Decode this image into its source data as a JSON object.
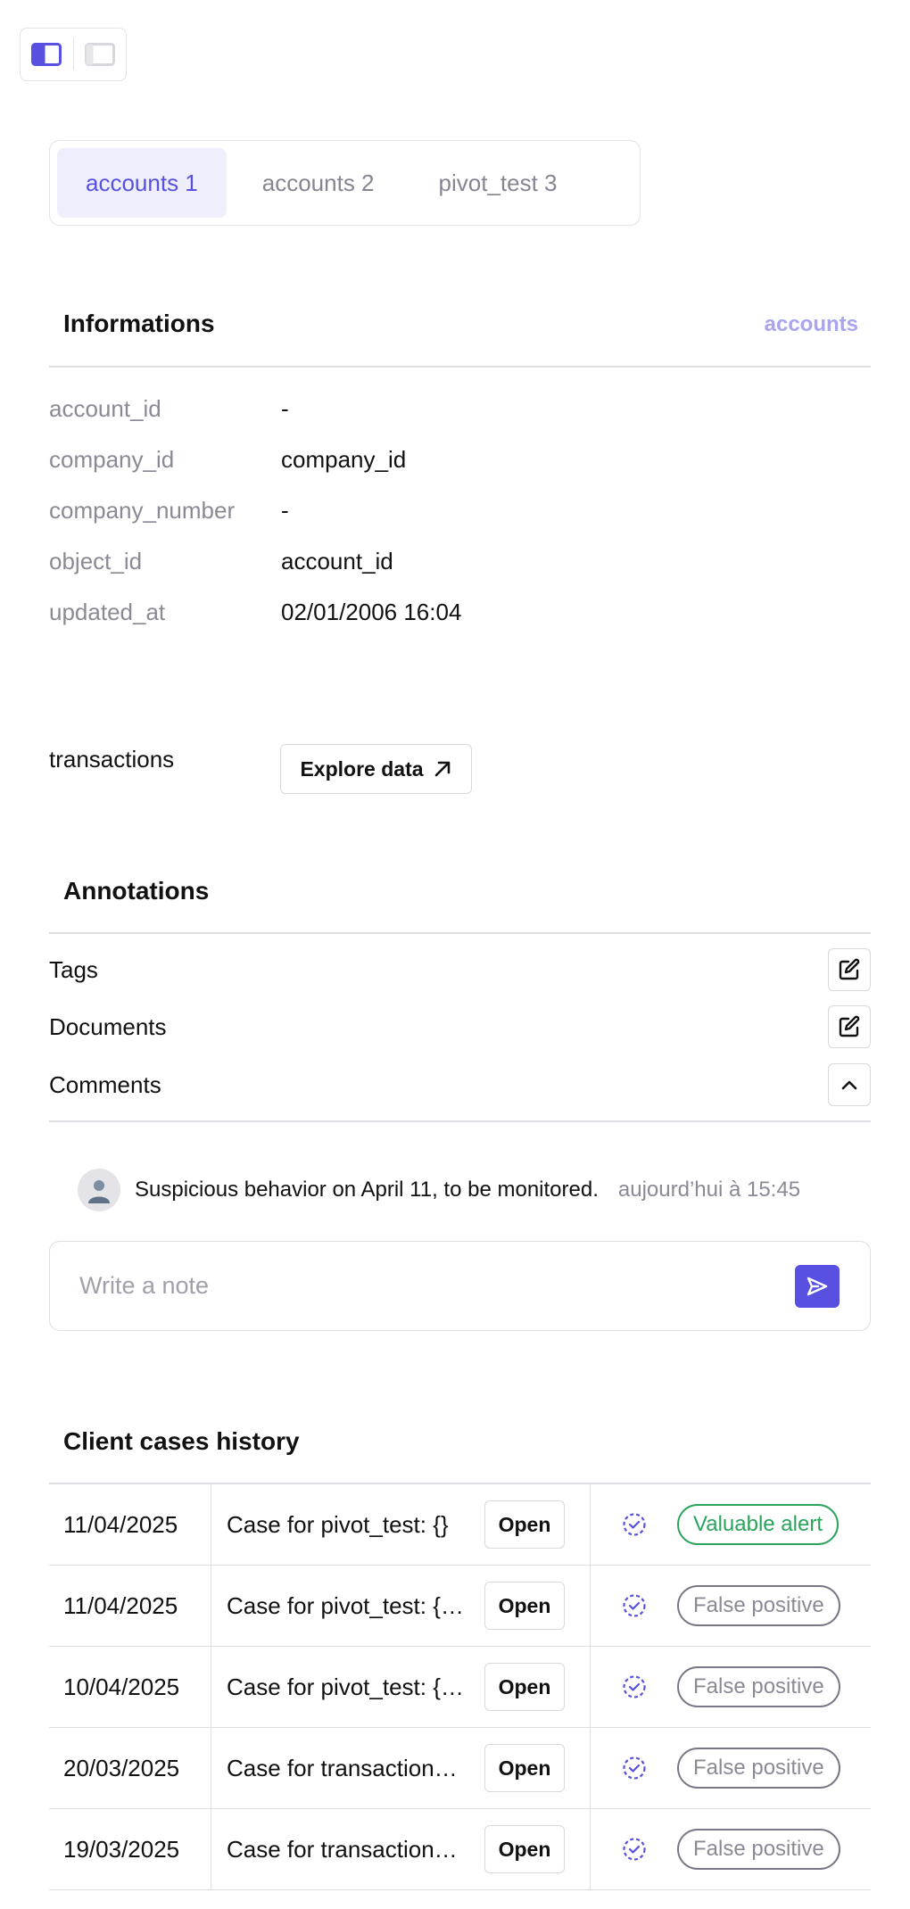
{
  "tabs": [
    {
      "label": "accounts 1",
      "active": true
    },
    {
      "label": "accounts 2",
      "active": false
    },
    {
      "label": "pivot_test 3",
      "active": false
    }
  ],
  "informations": {
    "title": "Informations",
    "link_label": "accounts",
    "fields": [
      {
        "key": "account_id",
        "value": "-"
      },
      {
        "key": "company_id",
        "value": "company_id"
      },
      {
        "key": "company_number",
        "value": "-"
      },
      {
        "key": "object_id",
        "value": "account_id"
      },
      {
        "key": "updated_at",
        "value": "02/01/2006 16:04"
      }
    ]
  },
  "transactions": {
    "label": "transactions",
    "button_label": "Explore data"
  },
  "annotations": {
    "title": "Annotations",
    "tags_label": "Tags",
    "documents_label": "Documents",
    "comments_label": "Comments",
    "comment": {
      "text": "Suspicious behavior on April 11, to be monitored.",
      "time": "aujourd’hui à 15:45"
    },
    "note_placeholder": "Write a note"
  },
  "cases": {
    "title": "Client cases history",
    "open_label": "Open",
    "rows": [
      {
        "date": "11/04/2025",
        "name": "Case for pivot_test: {}",
        "outcome": "Valuable alert",
        "kind": "valuable"
      },
      {
        "date": "11/04/2025",
        "name": "Case for pivot_test: {\"account_id\": ...",
        "outcome": "False positive",
        "kind": "false"
      },
      {
        "date": "10/04/2025",
        "name": "Case for pivot_test: {\"account_id\": ...",
        "outcome": "False positive",
        "kind": "false"
      },
      {
        "date": "20/03/2025",
        "name": "Case for transactions: ...",
        "outcome": "False positive",
        "kind": "false"
      },
      {
        "date": "19/03/2025",
        "name": "Case for transactions: ...",
        "outcome": "False positive",
        "kind": "false"
      }
    ]
  },
  "colors": {
    "accent": "#5750e0",
    "accent_light": "#eeeefc",
    "valuable": "#2aa35b",
    "false_positive": "#777785"
  }
}
